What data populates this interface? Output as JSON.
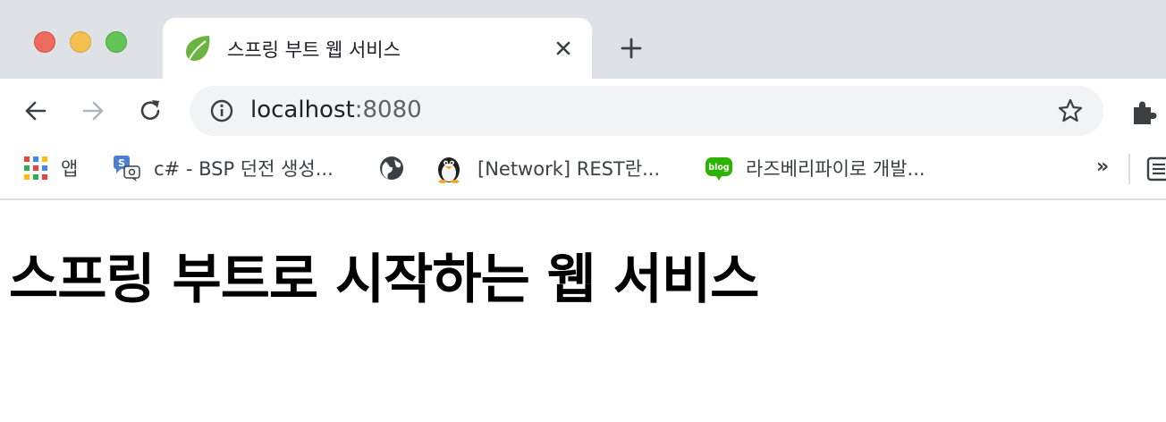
{
  "window": {
    "tab_title": "스프링 부트 웹 서비스"
  },
  "address_bar": {
    "host": "localhost",
    "port": ":8080"
  },
  "bookmarks": [
    {
      "label": "앱",
      "icon": "apps-grid-icon"
    },
    {
      "label": "c# - BSP 던전 생성...",
      "icon": "stackoverflow-icon"
    },
    {
      "label": "",
      "icon": "globe-icon"
    },
    {
      "label": "[Network] REST란...",
      "icon": "penguin-icon"
    },
    {
      "label": "라즈베리파이로 개발...",
      "icon": "blog-icon"
    }
  ],
  "page": {
    "heading": "스프링 부트로 시작하는 웹 서비스"
  },
  "colors": {
    "titlebar": "#dee1e6",
    "omnibox": "#f1f3f4",
    "spring_green": "#6db33f"
  }
}
